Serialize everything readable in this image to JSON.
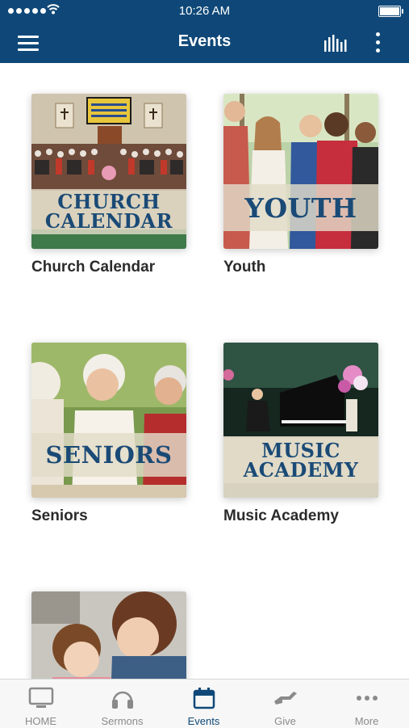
{
  "status_bar": {
    "time": "10:26 AM"
  },
  "nav": {
    "title": "Events",
    "icons": [
      "menu-icon",
      "bar-chart-icon",
      "more-vertical-icon"
    ]
  },
  "events": [
    {
      "label": "Church Calendar",
      "banner": [
        "CHURCH",
        "CALENDAR"
      ]
    },
    {
      "label": "Youth",
      "banner": [
        "YOUTH"
      ]
    },
    {
      "label": "Seniors",
      "banner": [
        "SENIORS"
      ]
    },
    {
      "label": "Music Academy",
      "banner": [
        "MUSIC",
        "ACADEMY"
      ]
    },
    {
      "label": "",
      "banner": []
    }
  ],
  "tabs": [
    {
      "label": "HOME",
      "icon": "tv-icon",
      "active": false
    },
    {
      "label": "Sermons",
      "icon": "headphones-icon",
      "active": false
    },
    {
      "label": "Events",
      "icon": "calendar-icon",
      "active": true
    },
    {
      "label": "Give",
      "icon": "hand-give-icon",
      "active": false
    },
    {
      "label": "More",
      "icon": "more-horizontal-icon",
      "active": false
    }
  ],
  "colors": {
    "brand": "#0f4878",
    "tab_active": "#0f4878",
    "tab_inactive": "#8a8a8a",
    "banner_text": "#1a4a76"
  }
}
